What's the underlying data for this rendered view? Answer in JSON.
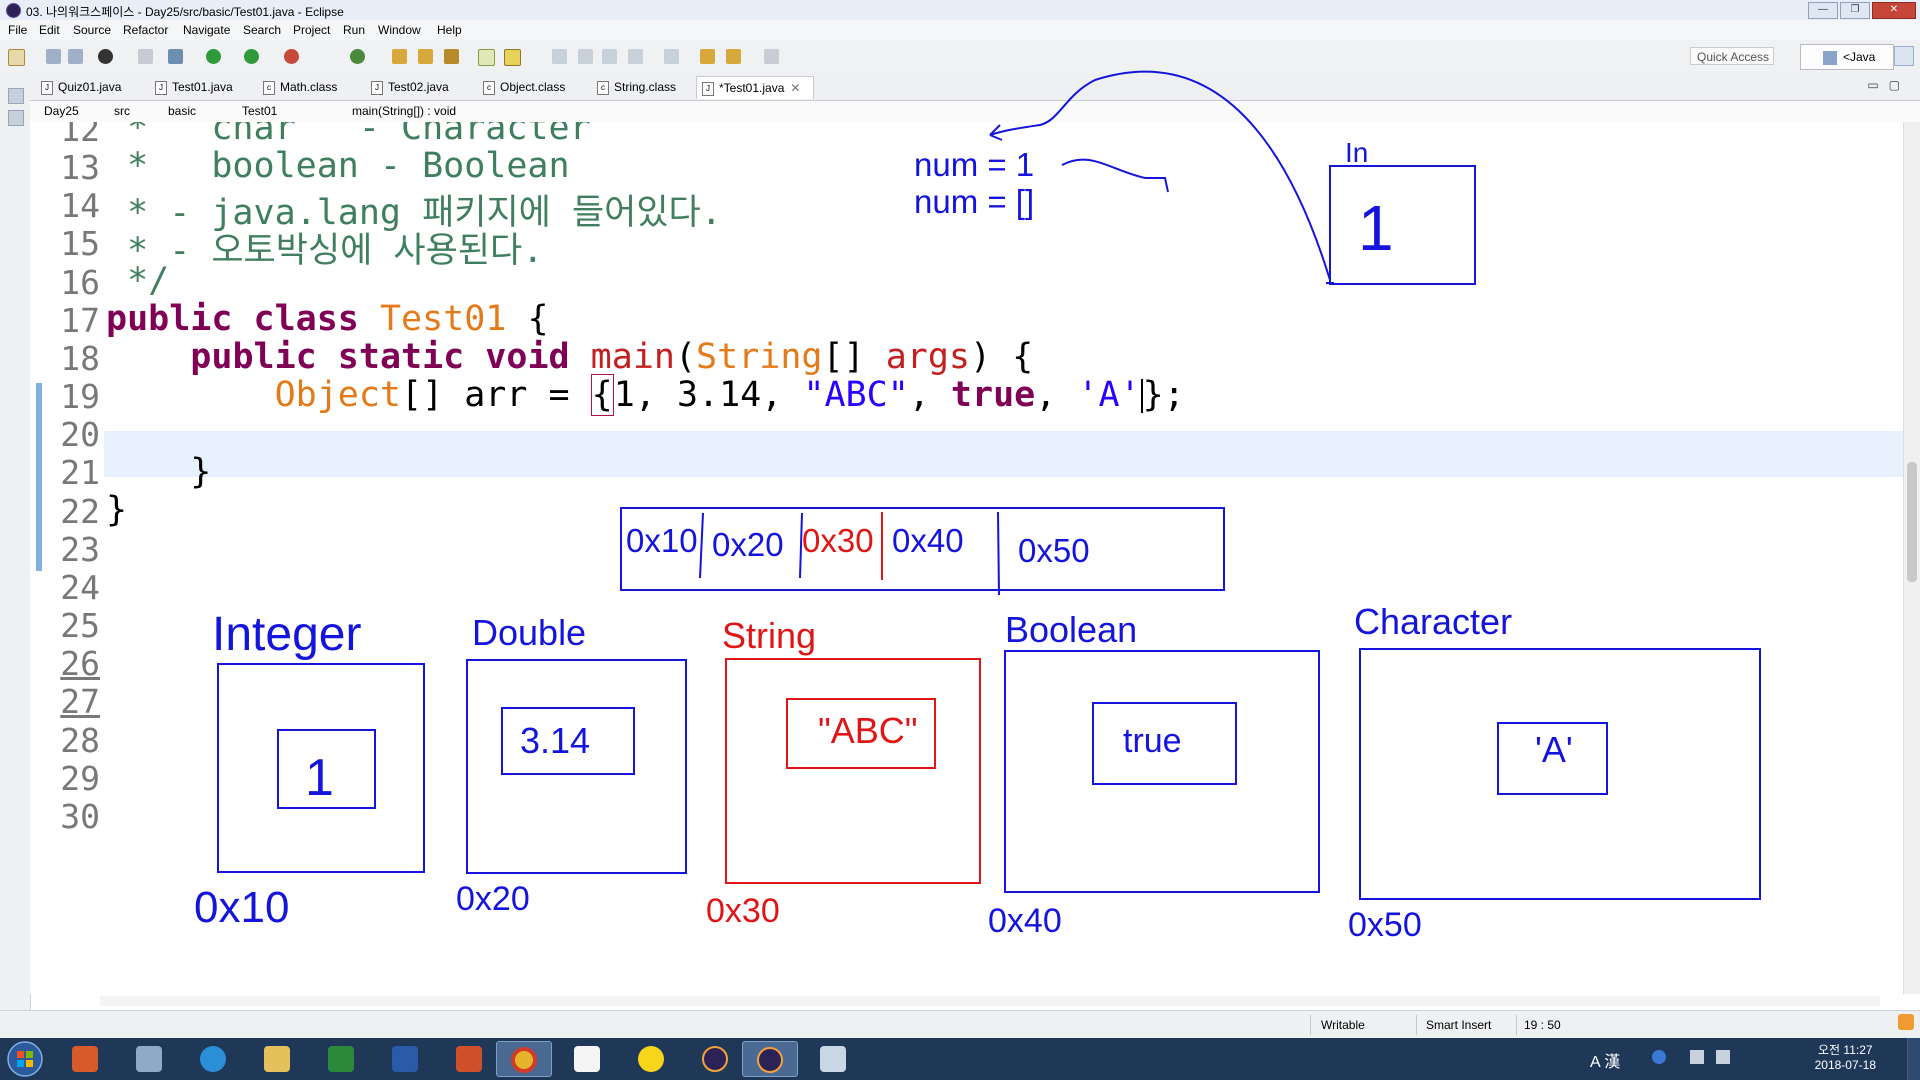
{
  "window": {
    "title": "03. 나의워크스페이스 - Day25/src/basic/Test01.java - Eclipse",
    "min": "—",
    "max": "❐",
    "close": "✕"
  },
  "menu": [
    "File",
    "Edit",
    "Source",
    "Refactor",
    "Navigate",
    "Search",
    "Project",
    "Run",
    "Window",
    "Help"
  ],
  "toolbar": {
    "quick_access": "Quick Access",
    "perspective": "<Java EE>"
  },
  "tabs": [
    {
      "label": "Quiz01.java"
    },
    {
      "label": "Test01.java"
    },
    {
      "label": "Math.class"
    },
    {
      "label": "Test02.java"
    },
    {
      "label": "Object.class"
    },
    {
      "label": "String.class"
    },
    {
      "label": "*Test01.java",
      "close": "✕"
    }
  ],
  "breadcrumb": [
    "Day25",
    "src",
    "basic",
    "Test01",
    "main(String[]) : void"
  ],
  "editor": {
    "line_numbers": [
      "12",
      "13",
      "14",
      "15",
      "16",
      "17",
      "18",
      "19",
      "20",
      "21",
      "22",
      "23",
      "24",
      "25",
      "26",
      "27",
      "28",
      "29",
      "30"
    ],
    "line12": " *   char   - Character",
    "line13": " *   boolean - Boolean",
    "line14": " * - java.lang 패키지에 들어있다.",
    "line15": " * - 오토박싱에 사용된다.",
    "line16": " */",
    "line17": {
      "kw": "public class ",
      "type": "Test01",
      "rest": " {"
    },
    "line18": {
      "indent": "    ",
      "kw": "public static void ",
      "method": "main",
      "open": "(",
      "type": "String",
      "mid": "[] ",
      "param": "args",
      "close": ") {"
    },
    "line19": {
      "indent": "        ",
      "type": "Object",
      "mid": "[] arr = ",
      "brace": "{",
      "v1": "1, 3.14, ",
      "str": "\"ABC\"",
      "sep": ", ",
      "kw": "true",
      "sep2": ", ",
      "chr": "'A'",
      "end": "};"
    },
    "line21": "    }",
    "line22": "}"
  },
  "annotations": {
    "num1": "num = 1",
    "num2": "num = []",
    "in_label": "In",
    "in_value": "1",
    "array_cells": [
      "0x10",
      "0x20",
      "0x30",
      "0x40",
      "0x50"
    ],
    "boxes": [
      {
        "type": "Integer",
        "value": "1",
        "addr": "0x10"
      },
      {
        "type": "Double",
        "value": "3.14",
        "addr": "0x20"
      },
      {
        "type": "String",
        "value": "\"ABC\"",
        "addr": "0x30"
      },
      {
        "type": "Boolean",
        "value": "true",
        "addr": "0x40"
      },
      {
        "type": "Character",
        "value": "'A'",
        "addr": "0x50"
      }
    ],
    "ink_blue": "#1414dc",
    "ink_red": "#e01515"
  },
  "status": {
    "writable": "Writable",
    "insert": "Smart Insert",
    "position": "19 : 50"
  },
  "taskbar": {
    "apps": [
      "media-player",
      "search-tool",
      "internet-explorer",
      "file-explorer",
      "excel",
      "word",
      "powerpoint",
      "chrome",
      "hangouts",
      "kakaotalk",
      "eclipse",
      "eclipse",
      "calculator"
    ],
    "ime": "A 漢",
    "clock_time": "오전 11:27",
    "clock_date": "2018-07-18"
  }
}
